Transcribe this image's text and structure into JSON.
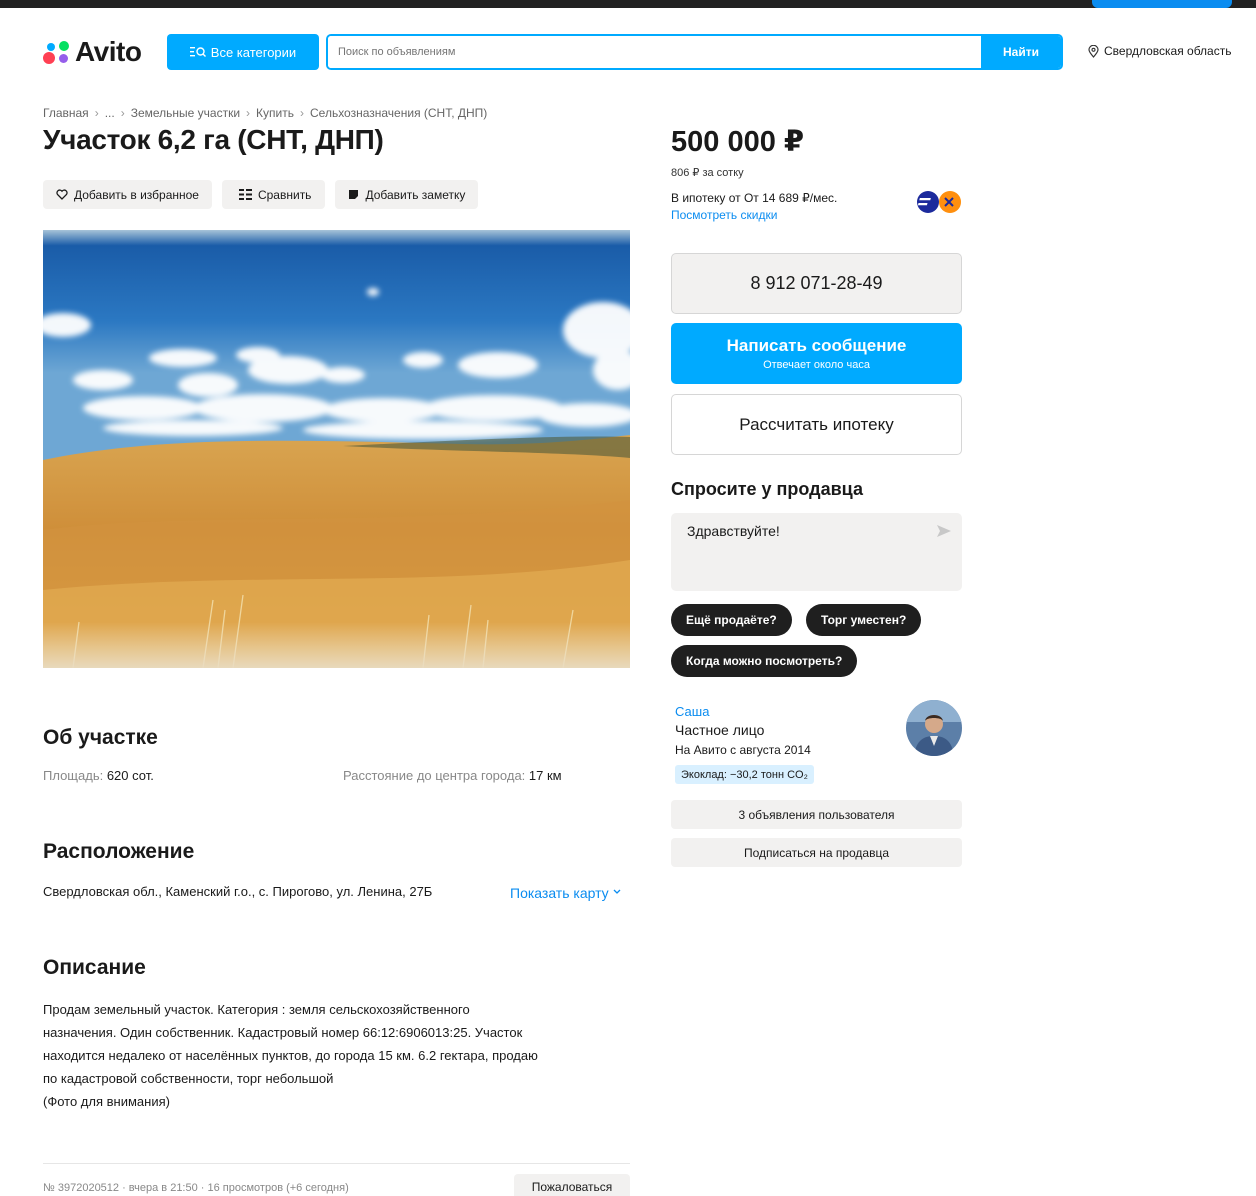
{
  "header": {
    "logo_text": "Avito",
    "categories_label": "Все категории",
    "search_placeholder": "Поиск по объявлениям",
    "search_button": "Найти",
    "region": "Свердловская область"
  },
  "breadcrumb": [
    "Главная",
    "...",
    "Земельные участки",
    "Купить",
    "Сельхозназначения (СНТ, ДНП)"
  ],
  "listing": {
    "title": "Участок 6,2 га (СНТ, ДНП)",
    "actions": {
      "favorite": "Добавить в избранное",
      "compare": "Сравнить",
      "note": "Добавить заметку"
    }
  },
  "about": {
    "title": "Об участке",
    "area_label": "Площадь:",
    "area_value": "620 сот.",
    "distance_label": "Расстояние до центра города:",
    "distance_value": "17 км"
  },
  "location": {
    "title": "Расположение",
    "address": "Свердловская обл., Каменский г.о., с. Пирогово, ул. Ленина, 27Б",
    "show_map": "Показать карту"
  },
  "description": {
    "title": "Описание",
    "lines": [
      "Продам земельный участок. Категория : земля сельскохозяйственного",
      "назначения. Один собственник. Кадастровый номер 66:12:6906013:25. Участок",
      "находится недалеко от населённых пунктов, до города 15 км. 6.2 гектара, продаю",
      "по кадастровой собственности, торг небольшой",
      "(Фото для внимания)"
    ]
  },
  "footer": {
    "meta": "№ 3972020512 · вчера в 21:50 · 16 просмотров (+6 сегодня)",
    "complain": "Пожаловаться"
  },
  "pricing": {
    "price": "500 000 ₽",
    "per_sotka": "806 ₽ за сотку",
    "mortgage": "В ипотеку от От 14 689 ₽/мес.",
    "discounts_link": "Посмотреть скидки"
  },
  "contact": {
    "phone": "8 912 071-28-49",
    "message_main": "Написать сообщение",
    "message_sub": "Отвечает около часа",
    "calc_mortgage": "Рассчитать ипотеку"
  },
  "ask": {
    "title": "Спросите у продавца",
    "input_value": "Здравствуйте!",
    "chips": [
      "Ещё продаёте?",
      "Торг уместен?",
      "Когда можно посмотреть?"
    ]
  },
  "seller": {
    "name": "Саша",
    "type": "Частное лицо",
    "since": "На Авито с августа 2014",
    "eco": "Экоклад: −30,2 тонн CO₂",
    "ads_button": "3 объявления пользователя",
    "subscribe_button": "Подписаться на продавца"
  },
  "colors": {
    "brand_blue": "#00aaff",
    "link_blue": "#0a8cf0",
    "light_gray": "#f2f1f0",
    "chip_dark": "#1f1f1f"
  }
}
